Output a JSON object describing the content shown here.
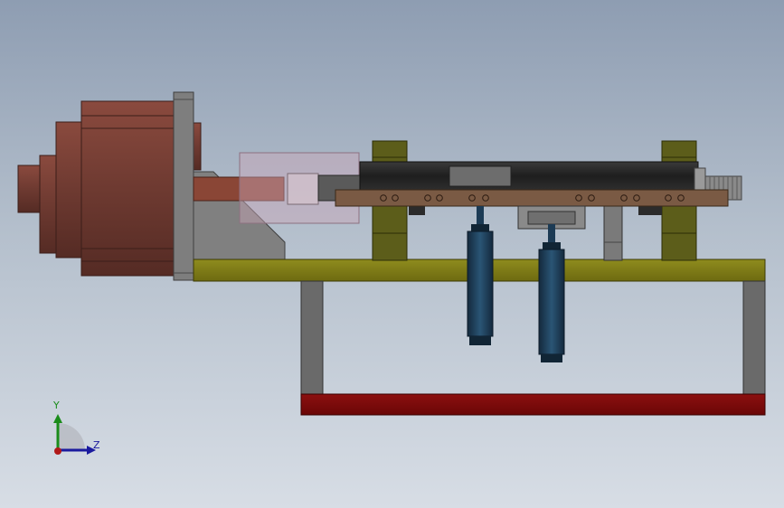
{
  "axis_triad": {
    "y_label": "Y",
    "z_label": "Z",
    "y_color": "#1a8c1a",
    "z_color": "#1a1a9e",
    "x_color": "#b01818"
  },
  "colors": {
    "motor": "#6e3a31",
    "flange": "#7e7e7e",
    "bracket": "#808080",
    "table_plate": "#7d7a14",
    "base_rail": "#7a0a0a",
    "leg": "#6a6a6a",
    "clamp_block": "#5c5d1a",
    "clamp_bar": "#7a5a44",
    "cylinder": "#1c3b55",
    "shaft": "#2f2f2f"
  }
}
